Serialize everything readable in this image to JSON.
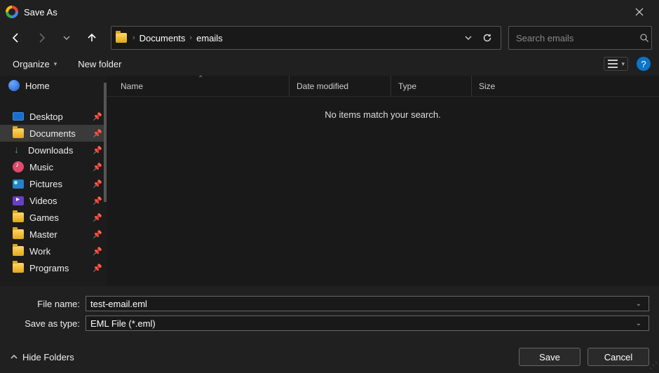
{
  "window": {
    "title": "Save As"
  },
  "nav": {
    "back_enabled": true,
    "forward_enabled": false,
    "up_enabled": true
  },
  "address": {
    "crumbs": [
      "Documents",
      "emails"
    ]
  },
  "search": {
    "placeholder": "Search emails"
  },
  "toolbar": {
    "organize": "Organize",
    "new_folder": "New folder"
  },
  "sidebar": {
    "home": "Home",
    "items": [
      {
        "label": "Desktop",
        "icon": "desktop"
      },
      {
        "label": "Documents",
        "icon": "folder",
        "selected": true
      },
      {
        "label": "Downloads",
        "icon": "download"
      },
      {
        "label": "Music",
        "icon": "music"
      },
      {
        "label": "Pictures",
        "icon": "picture"
      },
      {
        "label": "Videos",
        "icon": "video"
      },
      {
        "label": "Games",
        "icon": "folder"
      },
      {
        "label": "Master",
        "icon": "folder"
      },
      {
        "label": "Work",
        "icon": "folder"
      },
      {
        "label": "Programs",
        "icon": "folder"
      }
    ]
  },
  "columns": {
    "name": "Name",
    "date": "Date modified",
    "type": "Type",
    "size": "Size"
  },
  "content": {
    "empty_message": "No items match your search."
  },
  "form": {
    "file_name_label": "File name:",
    "file_name_value": "test-email.eml",
    "save_type_label": "Save as type:",
    "save_type_value": "EML File (*.eml)"
  },
  "footer": {
    "hide_folders": "Hide Folders",
    "save": "Save",
    "cancel": "Cancel"
  }
}
